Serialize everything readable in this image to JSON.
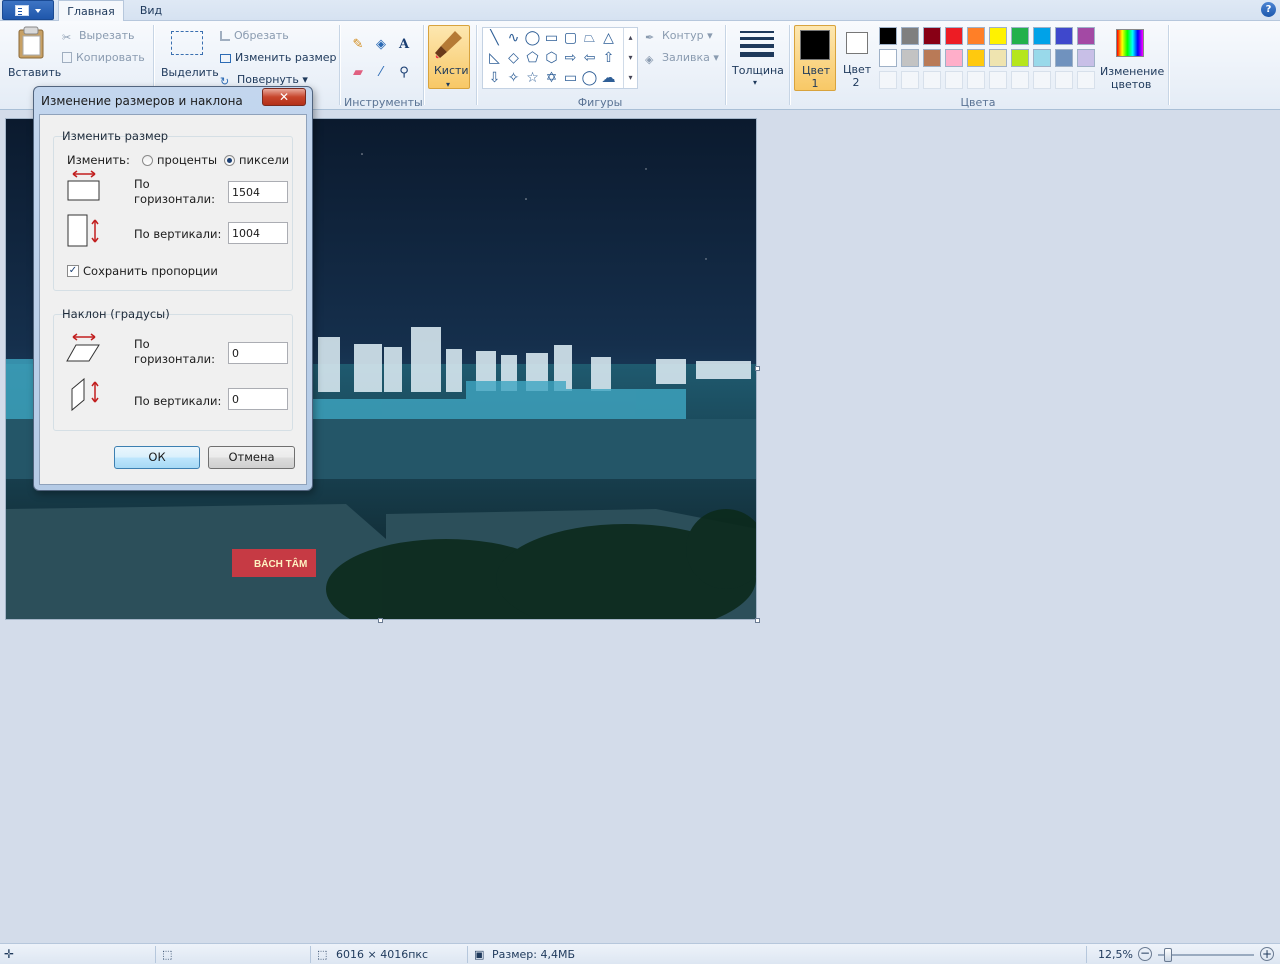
{
  "tabs": [
    {
      "label": "Главная",
      "active": true
    },
    {
      "label": "Вид",
      "active": false
    }
  ],
  "help_icon": "help-question-icon",
  "ribbon": {
    "clipboard": {
      "paste": "Вставить",
      "cut": "Вырезать",
      "copy": "Копировать"
    },
    "image": {
      "select": "Выделить",
      "crop": "Обрезать",
      "resize": "Изменить размер",
      "rotate": "Повернуть"
    },
    "tools": {
      "label": "Инструменты"
    },
    "brushes": {
      "label": "Кисти"
    },
    "shapes": {
      "label": "Фигуры",
      "outline": "Контур",
      "fill": "Заливка"
    },
    "thickness": {
      "label": "Толщина"
    },
    "color1": {
      "label_line1": "Цвет",
      "label_line2": "1",
      "value": "#000000"
    },
    "color2": {
      "label_line1": "Цвет",
      "label_line2": "2",
      "value": "#ffffff"
    },
    "colors": {
      "label": "Цвета",
      "palette_row1": [
        "#000000",
        "#7f7f7f",
        "#880015",
        "#ed1c24",
        "#ff7f27",
        "#fff200",
        "#22b14c",
        "#00a2e8",
        "#3f48cc",
        "#a349a4"
      ],
      "palette_row2": [
        "#ffffff",
        "#c3c3c3",
        "#b97a57",
        "#ffaec9",
        "#ffc90e",
        "#efe4b0",
        "#b5e61d",
        "#99d9ea",
        "#7092be",
        "#c8bfe7"
      ],
      "edit_line1": "Изменение",
      "edit_line2": "цветов"
    }
  },
  "dialog": {
    "title": "Изменение размеров и наклона",
    "close": "✕",
    "resize": {
      "title": "Изменить размер",
      "by_label": "Изменить:",
      "percent_label": "проценты",
      "pixels_label": "пиксели",
      "selected_unit": "pixels",
      "horizontal_line1": "По",
      "horizontal_line2": "горизонтали:",
      "horizontal_value": "1504",
      "vertical_label": "По вертикали:",
      "vertical_value": "1004",
      "keep_ratio_label": "Сохранить пропорции",
      "keep_ratio_checked": true
    },
    "skew": {
      "title": "Наклон (градусы)",
      "horizontal_line1": "По",
      "horizontal_line2": "горизонтали:",
      "horizontal_value": "0",
      "vertical_label": "По вертикали:",
      "vertical_value": "0"
    },
    "ok": "ОК",
    "cancel": "Отмена"
  },
  "status": {
    "image_size": "6016 × 4016пкс",
    "file_size": "Размер: 4,4МБ",
    "zoom": "12,5%"
  }
}
